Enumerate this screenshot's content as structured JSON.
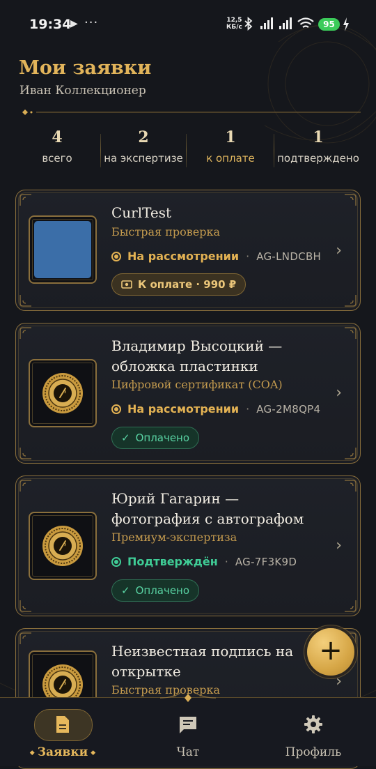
{
  "status_bar": {
    "time": "19:34",
    "speed_value": "12,5",
    "speed_unit": "КБ/с",
    "battery": "95",
    "icons": [
      "play-icon",
      "more-dots-icon",
      "bluetooth-icon",
      "signal-icon",
      "signal-icon",
      "wifi-icon",
      "battery-icon",
      "charging-icon"
    ]
  },
  "header": {
    "title": "Мои заявки",
    "subtitle": "Иван Коллекционер"
  },
  "stats": [
    {
      "value": "4",
      "label": "всего"
    },
    {
      "value": "2",
      "label": "на экспертизе"
    },
    {
      "value": "1",
      "label": "к оплате"
    },
    {
      "value": "1",
      "label": "подтверждено"
    }
  ],
  "requests": [
    {
      "title_lines": [
        "CurlTest"
      ],
      "service": "Быстрая проверка",
      "status": "На рассмотрении",
      "code": "AG-LNDCBH",
      "badge": "К оплате · 990 ₽",
      "thumb": "blue-placeholder"
    },
    {
      "title_lines": [
        "Владимир Высоцкий —",
        "обложка пластинки"
      ],
      "service": "Цифровой сертификат (COA)",
      "status": "На рассмотрении",
      "code": "AG-2M8QP4",
      "badge": "Оплачено",
      "thumb": "gold-seal"
    },
    {
      "title_lines": [
        "Юрий Гагарин —",
        "фотография с автографом"
      ],
      "service": "Премиум-экспертиза",
      "status": "Подтверждён",
      "code": "AG-7F3K9D",
      "badge": "Оплачено",
      "thumb": "gold-seal"
    },
    {
      "title_lines": [
        "Неизвестная подпись на",
        "открытке"
      ],
      "service": "Быстрая проверка",
      "thumb": "gold-seal"
    }
  ],
  "separator": "·",
  "fab_label": "+",
  "nav": [
    {
      "label": "Заявки",
      "icon": "document-icon",
      "active": true
    },
    {
      "label": "Чат",
      "icon": "chat-icon",
      "active": false
    },
    {
      "label": "Профиль",
      "icon": "gear-icon",
      "active": false
    }
  ],
  "colors": {
    "background": "#15171c",
    "gold": "#e2b45a",
    "pending": "#e3b253",
    "confirmed": "#3fcc96",
    "card_border": "#8a6f3c"
  }
}
